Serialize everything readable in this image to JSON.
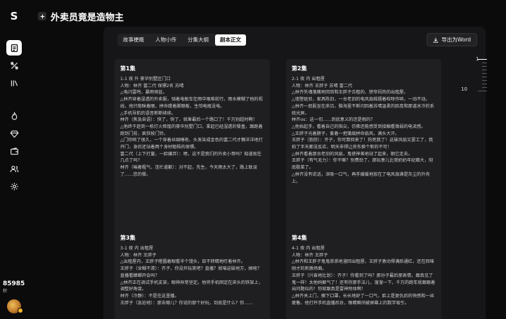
{
  "app": {
    "logo_text": "S",
    "title": "外卖员竟是造物主",
    "title_icon": "sparkle-icon"
  },
  "rail": {
    "items": [
      {
        "name": "script-nav",
        "icon": "document-icon",
        "active": true
      },
      {
        "name": "tools-nav",
        "icon": "tools-icon",
        "active": false
      },
      {
        "name": "library-nav",
        "icon": "library-icon",
        "active": false
      },
      {
        "name": "hot-nav",
        "icon": "flame-icon",
        "active": false
      },
      {
        "name": "vip-nav",
        "icon": "diamond-icon",
        "active": false
      },
      {
        "name": "wallet-nav",
        "icon": "wallet-icon",
        "active": false
      },
      {
        "name": "team-nav",
        "icon": "users-icon",
        "active": false
      },
      {
        "name": "settings-nav",
        "icon": "gear-icon",
        "active": false
      }
    ],
    "credits_value": "85985",
    "credits_unit": "积"
  },
  "tabs": [
    {
      "label": "故事梗概",
      "active": false
    },
    {
      "label": "人物小传",
      "active": false
    },
    {
      "label": "分集大纲",
      "active": false
    },
    {
      "label": "剧本正文",
      "active": true
    }
  ],
  "export_label": "导出为Word",
  "episodes": [
    {
      "title": "第1集",
      "body": "1-1 夜 外 豪华别墅区门口\n人物：林齐 富二代 保镖2名 苏晴\n△电闪雷鸣，暴雨倾盆。\n△林齐穿着湿透的外卖服，骑着电瓶车在雨中艰难前行。雨水模糊了他的视线，他只能眯着眼，拼命蹬着脚踏板，生怕电瓶没电。\n△手机导航的语音断断续续。\n林齐（焦急自语）：快了，快了，就差最后一个路口了！千万别超时啊！\n△他终于赶到一栋灯火辉煌的豪华别墅门口，拿起已经湿透的餐盒，跟跑着跑到门前，疯狂按门铃。\n△门铃响了很久，一个穿着丝绸睡袍、头发染成金色的富二代才懒洋洋地打开门，身后还站着两个身材魁梧的保镖。\n富二代（上下打量，一脸嫌弃）：啧，这不是我们的外卖小哥吗？知道现在几点了吗？\n林齐（喘着粗气，连忙道歉）：对不起，先生，今天雨太大了，路上耽误了……您的餐。"
    },
    {
      "title": "第2集",
      "body": "2-1 夜 内 出租屋\n人物：林齐 王胖子 苏晴 富二代\n△林齐失魂落魄地回到和王胖子合租的、狭窄闷热的出租屋。\n△墙壁斑驳，家具陈旧，一台老旧的电风扇摇摆着吱呀作响，一动不动。\n△林齐一屁股坐在床沿，脑海里不断闪回着苏晴温柔的脸庞和那道冰冷的系统光屏。\n林齐os：这一切……到底意义的还是假的？\n△他抬起手，看着自己的指尖，仿佛还能感受到接触看微弱的电流感。\n△王胖子光着膀子，套着一把蒲扇拼命扇风，满头大汗。\n王胖子（抱怨）：齐子，你可算回来了！热死我了！这破风扇又罢工了，我拍了半天都没反应，明天非得让房东换个新的不可！\n△林齐看着那台老旧的风扇，鬼使神差地站了起来，朝它走去。\n王胖子（有气无力）：你干嘛？别费劲了，那玩意儿比我奶奶年纪都大，彻底歇菜了。\n△林齐没有说话，深吸一口气，再手缓缓地放在了电风扇满是灰尘的外壳上。"
    },
    {
      "title": "第3集",
      "body": "3-1 夜 内 出租屋\n人物：林齐 王胖子\n△出租屋内，王胖子瞪圆着眼看半个馒头，目不转睛地盯着林齐。\n王胖子（含糊不清）：齐子，你没开玩笑吧？直播？就咱这破地方，搞啥？直播看蟑螂开会吗？\n△林齐正在调试手机支架，眼神异常坚定。他将手机固定在床头的铁架上，调整好角度。\n林齐（冷静）：不是在这里播。\n王胖子（急迫地）：那去哪儿？你说的那个好玩，到底是什么？你……"
    },
    {
      "title": "第4集",
      "body": "4-1 夜 内 出租屋\n人物：林齐 王胖子\n△林齐和王胖子鬼鬼祟祟地溜回出租屋，王胖子激动得满脸通红，还在回味刚才的刺激场面。\n王胖子（兴奋地比划）：齐子！你看到了吗？那孙子最后那表情，跟真见了鬼一样！太他妈解气了！还有你那手法儿，溜溜一下，千万的跑车就跟跟着出问题似的！你就跟真是雷神附体啊！\n△林齐关上门，摘下口罩，长长地舒了一口气，脸上是复仇后的快感和一丝疲惫。他打开手机直播后台，眼睛瞬间被屏幕上的数字吸引。"
    }
  ],
  "scrubber": {
    "start_label": "1",
    "end_label": "10"
  },
  "colors": {
    "background": "#0b0b0c",
    "panel": "#161618",
    "card": "#1f1f22",
    "accent": "#f5b82e"
  }
}
